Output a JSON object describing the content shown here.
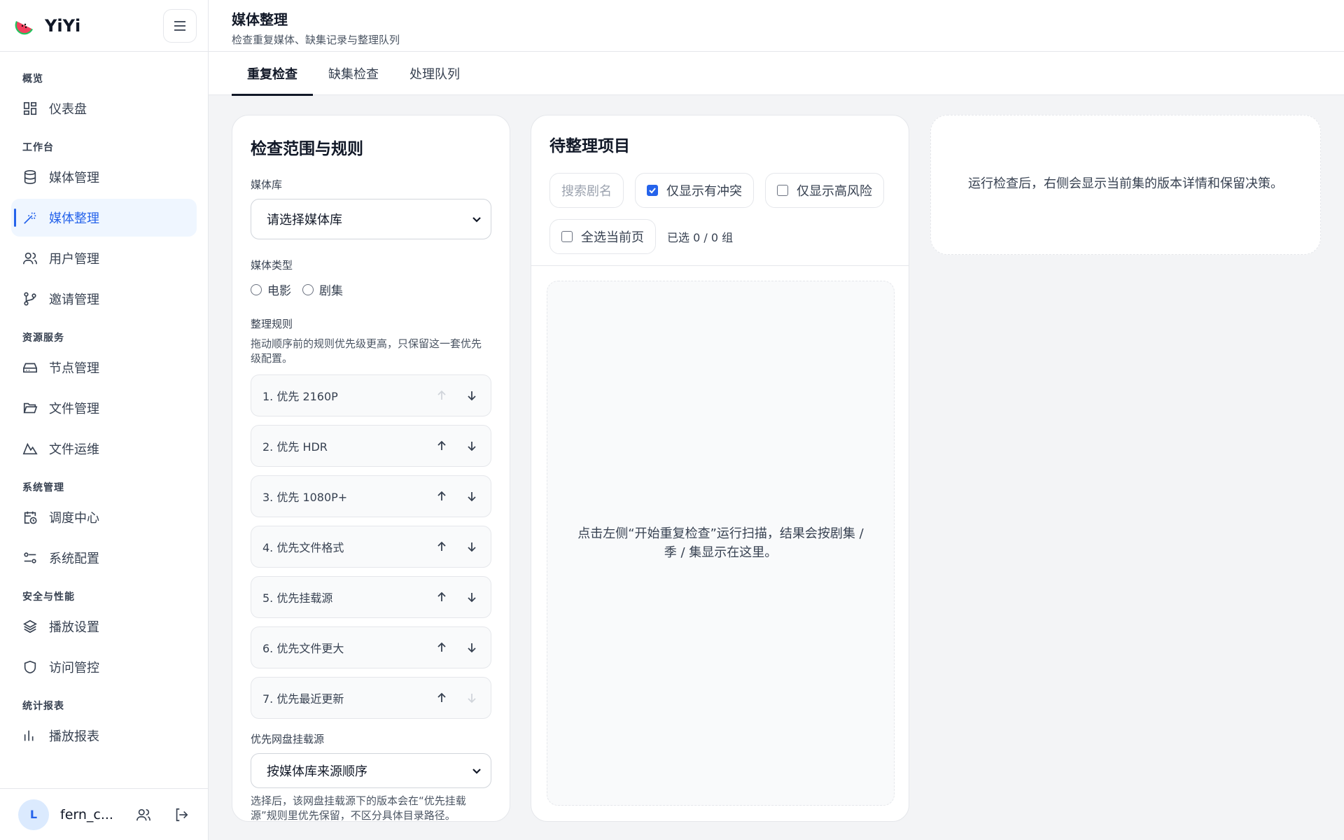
{
  "app": {
    "name": "YiYi"
  },
  "sidebar": {
    "groups": [
      {
        "title": "概览",
        "items": [
          {
            "label": "仪表盘",
            "icon": "dashboard-icon"
          }
        ]
      },
      {
        "title": "工作台",
        "items": [
          {
            "label": "媒体管理",
            "icon": "database-icon"
          },
          {
            "label": "媒体整理",
            "icon": "magic-wand-icon",
            "active": true
          },
          {
            "label": "用户管理",
            "icon": "users-icon"
          },
          {
            "label": "邀请管理",
            "icon": "git-branch-icon"
          }
        ]
      },
      {
        "title": "资源服务",
        "items": [
          {
            "label": "节点管理",
            "icon": "hard-drive-icon"
          },
          {
            "label": "文件管理",
            "icon": "folder-icon"
          },
          {
            "label": "文件运维",
            "icon": "mountain-icon"
          }
        ]
      },
      {
        "title": "系统管理",
        "items": [
          {
            "label": "调度中心",
            "icon": "calendar-clock-icon"
          },
          {
            "label": "系统配置",
            "icon": "sliders-icon"
          }
        ]
      },
      {
        "title": "安全与性能",
        "items": [
          {
            "label": "播放设置",
            "icon": "layers-icon"
          },
          {
            "label": "访问管控",
            "icon": "shield-icon"
          }
        ]
      },
      {
        "title": "统计报表",
        "items": [
          {
            "label": "播放报表",
            "icon": "chart-icon"
          }
        ]
      }
    ],
    "user": {
      "initial": "L",
      "name": "fern_c..."
    }
  },
  "header": {
    "title": "媒体整理",
    "subtitle": "检查重复媒体、缺集记录与整理队列"
  },
  "tabs": [
    {
      "label": "重复检查",
      "active": true
    },
    {
      "label": "缺集检查"
    },
    {
      "label": "处理队列"
    }
  ],
  "left_card": {
    "title": "检查范围与规则",
    "library_label": "媒体库",
    "library_value": "请选择媒体库",
    "type_label": "媒体类型",
    "type_options": [
      "电影",
      "剧集"
    ],
    "rules_label": "整理规则",
    "rules_hint": "拖动顺序前的规则优先级更高，只保留这一套优先级配置。",
    "rules": [
      "1. 优先 2160P",
      "2. 优先 HDR",
      "3. 优先 1080P+",
      "4. 优先文件格式",
      "5. 优先挂载源",
      "6. 优先文件更大",
      "7. 优先最近更新"
    ],
    "mount_label": "优先网盘挂载源",
    "mount_value": "按媒体库来源顺序",
    "mount_hint": "选择后，该网盘挂载源下的版本会在“优先挂载源”规则里优先保留，不区分具体目录路径。"
  },
  "mid_card": {
    "title": "待整理项目",
    "search_placeholder": "搜索剧名",
    "filter_conflict": "仅显示有冲突",
    "filter_risk": "仅显示高风险",
    "select_page": "全选当前页",
    "selected_count": "已选 0 / 0 组",
    "empty_text": "点击左侧“开始重复检查”运行扫描，结果会按剧集 / 季 / 集显示在这里。"
  },
  "right_card": {
    "empty_text": "运行检查后，右侧会显示当前集的版本详情和保留决策。"
  },
  "colors": {
    "accent": "#2563eb",
    "border": "#e5e7eb"
  }
}
